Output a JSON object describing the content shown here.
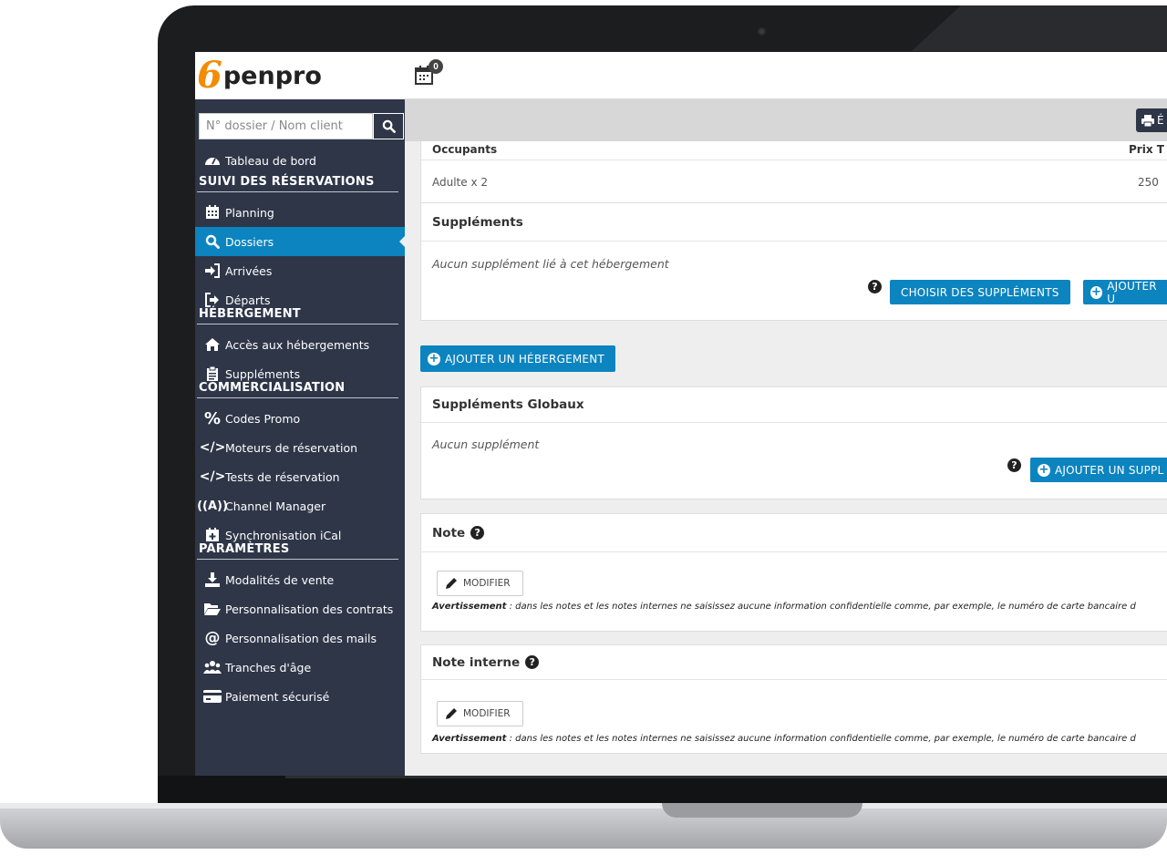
{
  "logo": {
    "mark": "6",
    "text": "penpro"
  },
  "search": {
    "placeholder": "N° dossier / Nom client"
  },
  "calendar_badge": "0",
  "print_label": "É",
  "sidebar": {
    "dashboard": "Tableau de bord",
    "sections": {
      "suivi": "SUIVI DES RÉSERVATIONS",
      "hebergement": "HÉBERGEMENT",
      "commercialisation": "COMMERCIALISATION",
      "parametres": "PARAMÈTRES"
    },
    "items": {
      "planning": "Planning",
      "dossiers": "Dossiers",
      "arrivees": "Arrivées",
      "departs": "Départs",
      "acces": "Accès aux hébergements",
      "supplements": "Suppléments",
      "codes": "Codes Promo",
      "moteurs": "Moteurs de réservation",
      "tests": "Tests de réservation",
      "channel": "Channel Manager",
      "ical": "Synchronisation iCal",
      "modalites": "Modalités de vente",
      "contrats": "Personnalisation des contrats",
      "mails": "Personnalisation des mails",
      "tranches": "Tranches d'âge",
      "paiement": "Paiement sécurisé"
    }
  },
  "occupants": {
    "col_occupants": "Occupants",
    "col_price": "Prix T",
    "row_label": "Adulte x 2",
    "row_price": "250"
  },
  "supplements": {
    "title": "Suppléments",
    "empty": "Aucun supplément lié à cet hébergement",
    "choose_btn": "CHOISIR DES SUPPLÉMENTS",
    "add_btn": "AJOUTER U"
  },
  "add_accommodation_btn": "AJOUTER UN HÉBERGEMENT",
  "global_supplements": {
    "title": "Suppléments Globaux",
    "empty": "Aucun supplément",
    "add_btn": "AJOUTER UN SUPPL"
  },
  "note": {
    "title": "Note",
    "modify": "MODIFIER",
    "warning_label": "Avertissement",
    "warning_text": " : dans les notes et les notes internes ne saisissez aucune information confidentielle comme, par exemple, le numéro de carte bancaire d"
  },
  "internal_note": {
    "title": "Note interne",
    "modify": "MODIFIER",
    "warning_label": "Avertissement",
    "warning_text": " : dans les notes et les notes internes ne saisissez aucune information confidentielle comme, par exemple, le numéro de carte bancaire d"
  },
  "colors": {
    "sidebar": "#2e3648",
    "accent": "#0c84bf",
    "logo": "#f28c00"
  }
}
